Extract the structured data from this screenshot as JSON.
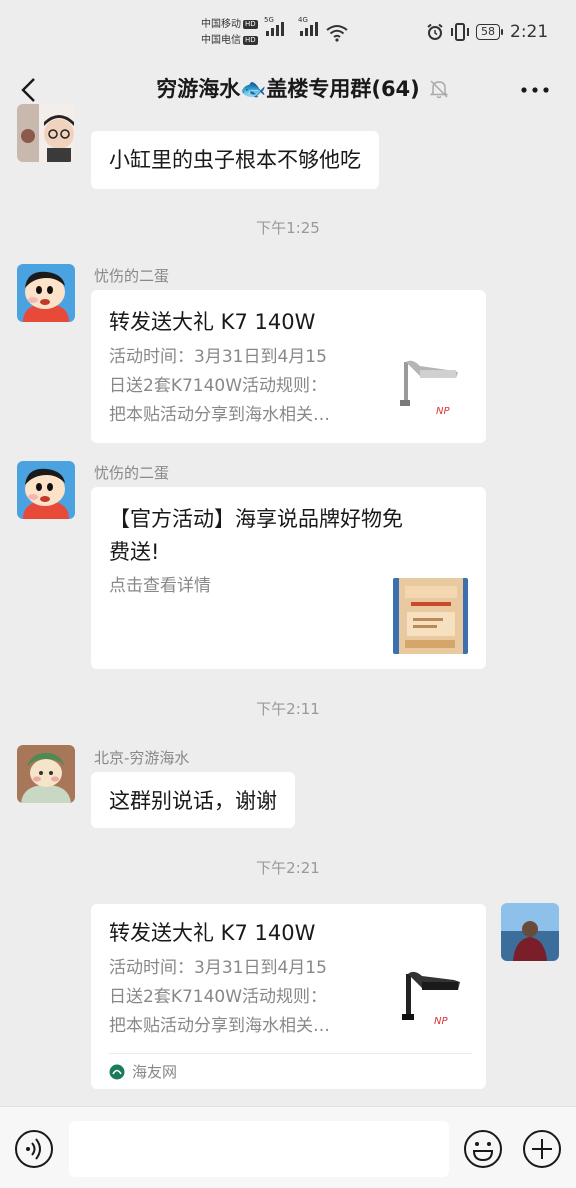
{
  "status_bar": {
    "carrier1": "中国移动",
    "carrier2": "中国电信",
    "hd": "HD",
    "net1": "5G",
    "net2": "4G",
    "battery": "58",
    "time": "2:21"
  },
  "header": {
    "title": "穷游海水🐟盖楼专用群(64)"
  },
  "messages": [
    {
      "type": "text",
      "sender": "",
      "text": "小缸里的虫子根本不够他吃"
    },
    {
      "type": "time",
      "text": "下午1:25"
    },
    {
      "type": "card",
      "sender": "忧伤的二蛋",
      "title": "转发送大礼 K7 140W",
      "desc": [
        "活动时间：3月31日到4月15",
        "日送2套K7140W活动规则：",
        "把本贴活动分享到海水相关…"
      ],
      "thumb_label": "NP"
    },
    {
      "type": "card",
      "sender": "忧伤的二蛋",
      "title_lines": [
        "【官方活动】海享说品牌好物免",
        "费送!"
      ],
      "desc": [
        "点击查看详情"
      ]
    },
    {
      "type": "time",
      "text": "下午2:11"
    },
    {
      "type": "text",
      "sender": "北京-穷游海水",
      "text": "这群别说话，谢谢"
    },
    {
      "type": "time",
      "text": "下午2:21"
    },
    {
      "type": "card_self",
      "title": "转发送大礼 K7 140W",
      "desc": [
        "活动时间：3月31日到4月15",
        "日送2套K7140W活动规则：",
        "把本贴活动分享到海水相关…"
      ],
      "thumb_label": "NP",
      "source": "海友网"
    }
  ],
  "colors": {
    "background": "#ededed",
    "bubble": "#ffffff",
    "meta_text": "#888888"
  }
}
